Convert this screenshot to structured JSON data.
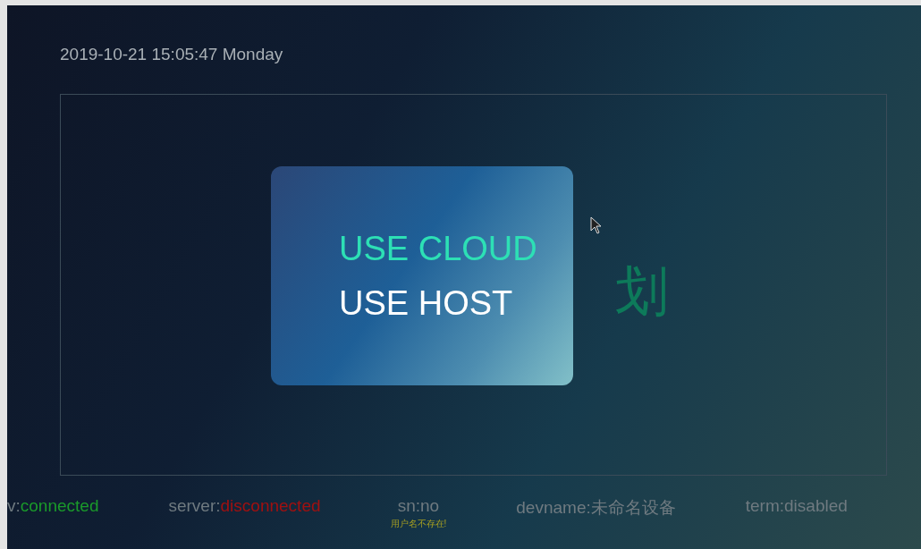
{
  "datetime": "2019-10-21 15:05:47  Monday",
  "background_title": "划",
  "dialog": {
    "options": [
      {
        "label": "USE CLOUD",
        "selected": true
      },
      {
        "label": "USE HOST",
        "selected": false
      }
    ]
  },
  "status_bar": [
    {
      "label": "v:",
      "value": "connected",
      "color": "#1a9a2a"
    },
    {
      "label": "server:",
      "value": "disconnected",
      "color": "#a01010"
    },
    {
      "label": "sn:",
      "value": "no",
      "color": "#6f7a80",
      "message": "用户名不存在!"
    },
    {
      "label": "devname:",
      "value": "未命名设备",
      "color": "#6f7a80"
    },
    {
      "label": "term:",
      "value": "disabled",
      "color": "#6f7a80"
    }
  ]
}
